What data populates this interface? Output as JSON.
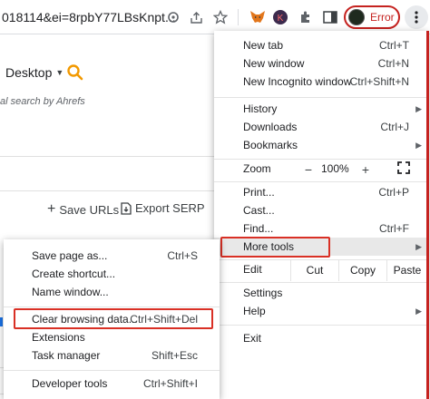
{
  "toolbar": {
    "url": "018114&ei=8rpbY77LBsKnpt...",
    "error_label": "Error"
  },
  "page": {
    "device_select": "Desktop",
    "ahrefs_note": "al search by Ahrefs",
    "save_urls": "Save URLs",
    "export_serp": "Export SERP"
  },
  "menu": {
    "items_top": [
      {
        "label": "New tab",
        "shortcut": "Ctrl+T"
      },
      {
        "label": "New window",
        "shortcut": "Ctrl+N"
      },
      {
        "label": "New Incognito window",
        "shortcut": "Ctrl+Shift+N"
      }
    ],
    "items_history": [
      {
        "label": "History",
        "shortcut": ""
      },
      {
        "label": "Downloads",
        "shortcut": "Ctrl+J"
      },
      {
        "label": "Bookmarks",
        "shortcut": ""
      }
    ],
    "zoom": {
      "label": "Zoom",
      "minus": "−",
      "value": "100%",
      "plus": "+"
    },
    "items_tools": [
      {
        "label": "Print...",
        "shortcut": "Ctrl+P"
      },
      {
        "label": "Cast...",
        "shortcut": ""
      },
      {
        "label": "Find...",
        "shortcut": "Ctrl+F"
      },
      {
        "label": "More tools",
        "shortcut": ""
      }
    ],
    "edit": {
      "label": "Edit",
      "cut": "Cut",
      "copy": "Copy",
      "paste": "Paste"
    },
    "items_bottom": [
      {
        "label": "Settings",
        "shortcut": ""
      },
      {
        "label": "Help",
        "shortcut": ""
      }
    ],
    "exit": "Exit"
  },
  "submenu": {
    "items_a": [
      {
        "label": "Save page as...",
        "shortcut": "Ctrl+S"
      },
      {
        "label": "Create shortcut...",
        "shortcut": ""
      },
      {
        "label": "Name window...",
        "shortcut": ""
      }
    ],
    "items_b": [
      {
        "label": "Clear browsing data...",
        "shortcut": "Ctrl+Shift+Del"
      },
      {
        "label": "Extensions",
        "shortcut": ""
      },
      {
        "label": "Task manager",
        "shortcut": "Shift+Esc"
      }
    ],
    "items_c": [
      {
        "label": "Developer tools",
        "shortcut": "Ctrl+Shift+I"
      }
    ]
  },
  "colors": {
    "highlight_red": "#d93025",
    "search_orange": "#f29900"
  }
}
